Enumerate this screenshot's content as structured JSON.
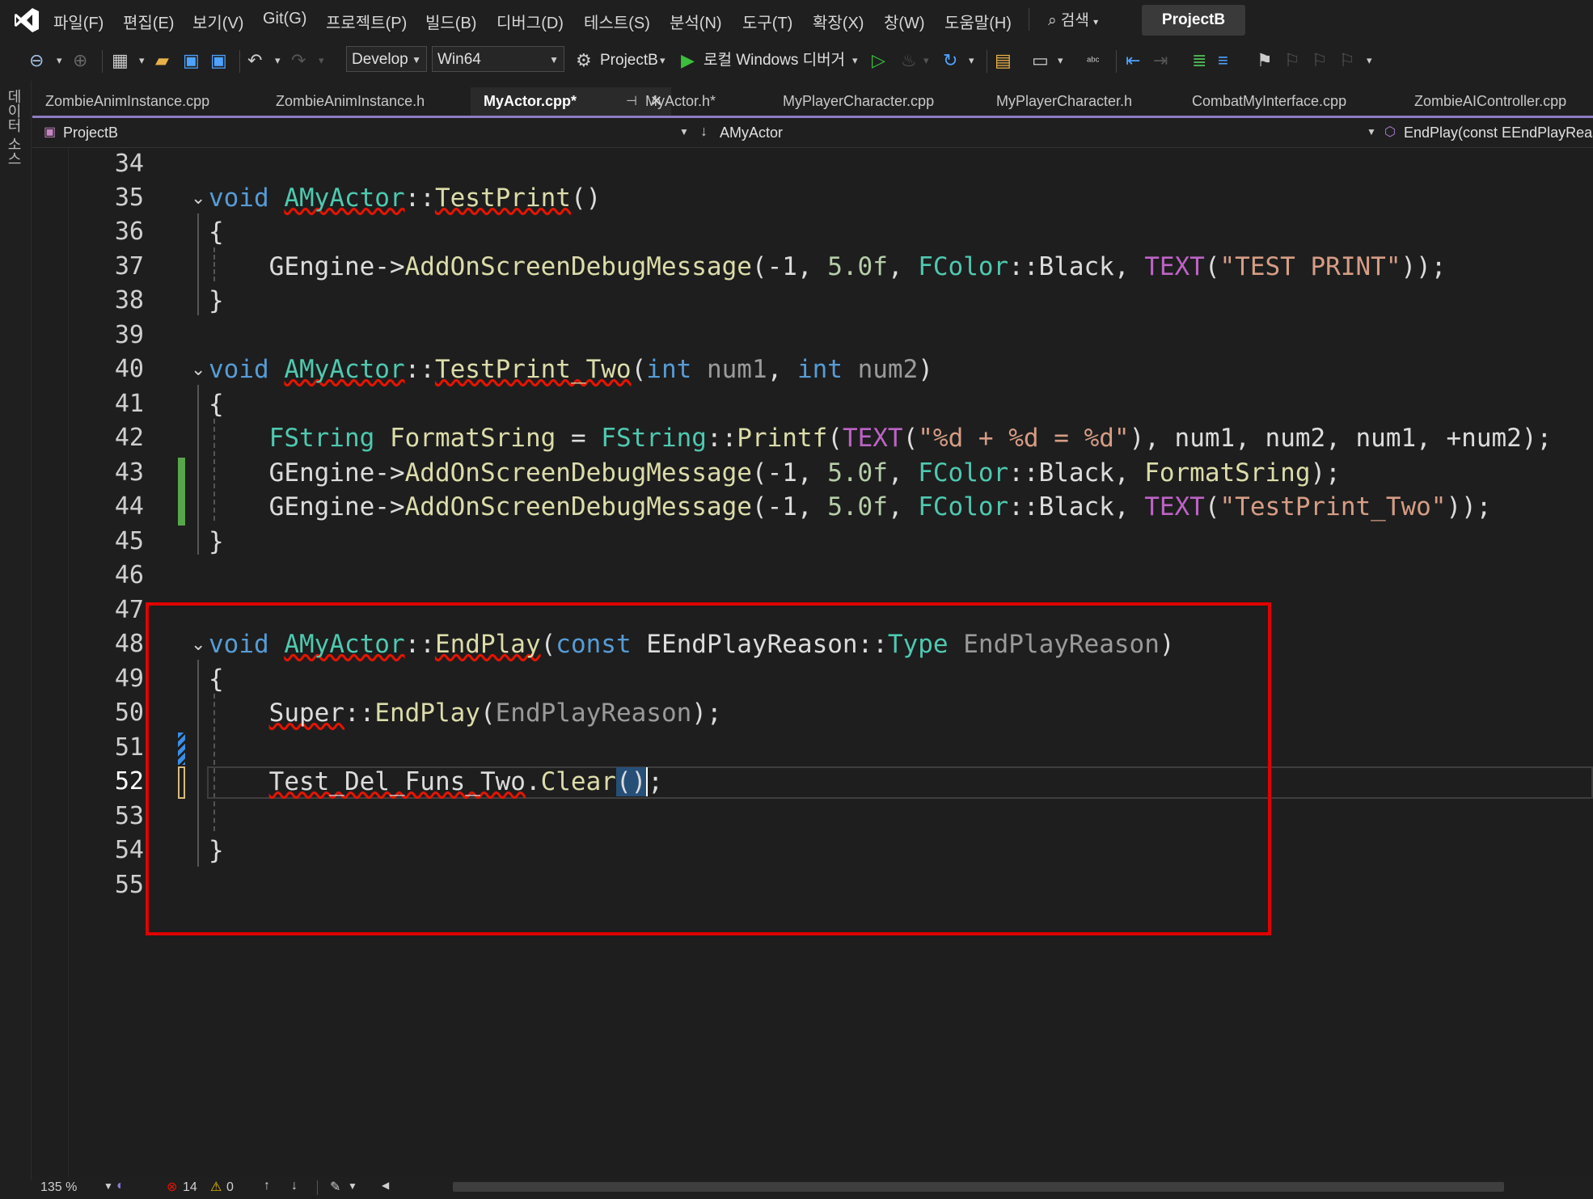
{
  "menu": {
    "items": [
      "파일(F)",
      "편집(E)",
      "보기(V)",
      "Git(G)",
      "프로젝트(P)",
      "빌드(B)",
      "디버그(D)",
      "테스트(S)",
      "분석(N)",
      "도구(T)",
      "확장(X)",
      "창(W)",
      "도움말(H)"
    ],
    "search_label": "검색",
    "project_badge": "ProjectB"
  },
  "toolbar": {
    "config": "Develop",
    "platform": "Win64",
    "startup_project": "ProjectB",
    "debugger_label": "로컬 Windows 디버거"
  },
  "left_strip": {
    "label": "데이터 소스"
  },
  "tabs": [
    {
      "label": "ZombieAnimInstance.cpp",
      "active": false
    },
    {
      "label": "ZombieAnimInstance.h",
      "active": false
    },
    {
      "label": "MyActor.cpp*",
      "active": true
    },
    {
      "label": "MyActor.h*",
      "active": false
    },
    {
      "label": "MyPlayerCharacter.cpp",
      "active": false
    },
    {
      "label": "MyPlayerCharacter.h",
      "active": false
    },
    {
      "label": "CombatMyInterface.cpp",
      "active": false
    },
    {
      "label": "ZombieAIController.cpp",
      "active": false
    }
  ],
  "navbar": {
    "project": "ProjectB",
    "scope": "AMyActor",
    "member": "EndPlay(const EEndPlayReason::T"
  },
  "editor": {
    "line_numbers": [
      "34",
      "35",
      "36",
      "37",
      "38",
      "39",
      "40",
      "41",
      "42",
      "43",
      "44",
      "45",
      "46",
      "47",
      "48",
      "49",
      "50",
      "51",
      "52",
      "53",
      "54",
      "55"
    ]
  },
  "statusbar": {
    "zoom": "135 %",
    "errors": "14",
    "warnings": "0"
  },
  "colors": {
    "keyword": "#569cd6",
    "type": "#4ec9b0",
    "function": "#dcdcaa",
    "string": "#d69d85",
    "macro": "#bd63c5",
    "highlight_box": "#e00000",
    "change_marker_saved": "#57a64a",
    "change_marker_unsaved": "#d7ba7d"
  }
}
